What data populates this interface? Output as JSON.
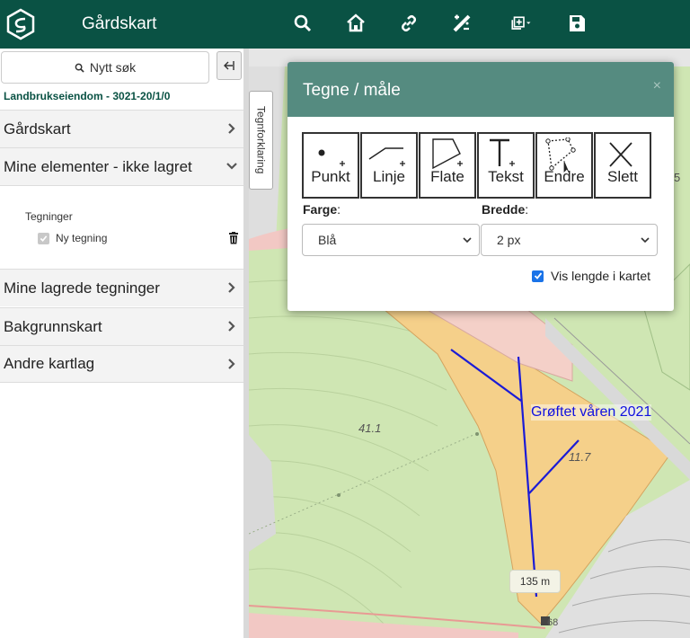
{
  "header": {
    "title": "Gårdskart",
    "icons": [
      "search-icon",
      "home-icon",
      "link-icon",
      "measure-tools-icon",
      "add-layer-icon",
      "save-icon"
    ],
    "color": "#0a5244"
  },
  "sidebar": {
    "search_label": "Nytt søk",
    "property": "Landbrukseiendom - 3021-20/1/0",
    "items": [
      {
        "label": "Gårdskart"
      },
      {
        "label": "Mine elementer - ikke lagret"
      },
      {
        "label": "Mine lagrede tegninger"
      },
      {
        "label": "Bakgrunnskart"
      },
      {
        "label": "Andre kartlag"
      }
    ],
    "expanded": {
      "heading": "Tegninger",
      "drawing_label": "Ny tegning"
    }
  },
  "map": {
    "legend_tab": "Tegnforklaring",
    "area_label_1": "41.1",
    "area_label_2": "11.7",
    "area_label_3": "68",
    "area_label_4": "5",
    "annotation": "Grøftet våren 2021",
    "length": "135 m"
  },
  "dialog": {
    "title": "Tegne / måle",
    "close": "×",
    "tools": [
      {
        "label": "Punkt",
        "icon": "point-icon"
      },
      {
        "label": "Linje",
        "icon": "line-icon"
      },
      {
        "label": "Flate",
        "icon": "polygon-icon"
      },
      {
        "label": "Tekst",
        "icon": "text-icon"
      },
      {
        "label": "Endre",
        "icon": "edit-icon"
      },
      {
        "label": "Slett",
        "icon": "delete-icon"
      }
    ],
    "color_label": "Farge",
    "width_label": "Bredde",
    "color_value": "Blå",
    "width_value": "2 px",
    "show_length_label": "Vis lengde i kartet",
    "show_length_checked": true
  }
}
